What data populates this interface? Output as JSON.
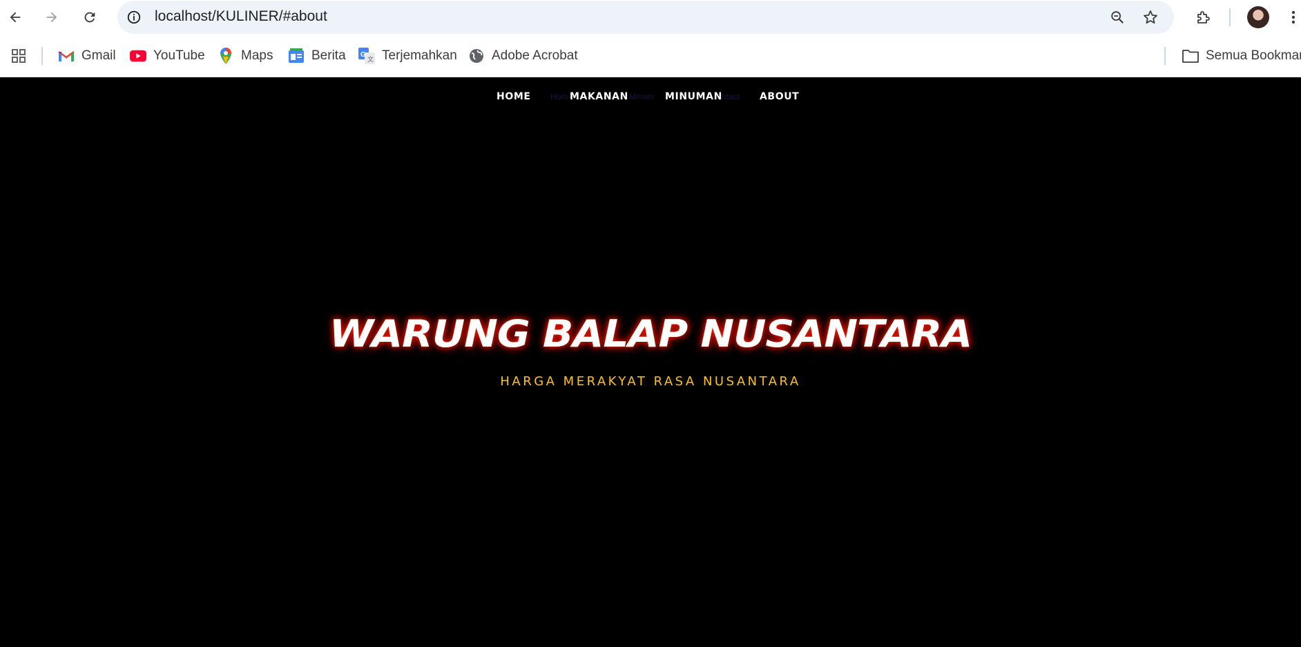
{
  "browser": {
    "url": "localhost/KULINER/#about",
    "icons": [
      "back-icon",
      "forward-icon",
      "reload-icon",
      "site-info-icon",
      "zoom-icon",
      "star-icon",
      "extensions-icon",
      "profile-avatar",
      "menu-icon"
    ]
  },
  "bookmarks": {
    "items": [
      {
        "label": "Gmail",
        "icon": "gmail-icon"
      },
      {
        "label": "YouTube",
        "icon": "youtube-icon"
      },
      {
        "label": "Maps",
        "icon": "maps-icon"
      },
      {
        "label": "Berita",
        "icon": "news-icon"
      },
      {
        "label": "Terjemahkan",
        "icon": "translate-icon"
      },
      {
        "label": "Adobe Acrobat",
        "icon": "globe-icon"
      }
    ],
    "all_bookmarks": "Semua Bookmark"
  },
  "site": {
    "nav": [
      "HOME",
      "MAKANAN",
      "MINUMAN",
      "ABOUT"
    ],
    "ghost_nav": [
      "Hom",
      "|",
      "Minum",
      "ntact"
    ],
    "title": "WARUNG BALAP NUSANTARA",
    "subtitle": "HARGA MERAKYAT RASA NUSANTARA"
  },
  "colors": {
    "background": "#000000",
    "title_glow": "#ff1e00",
    "subtitle": "#ffc21a"
  }
}
